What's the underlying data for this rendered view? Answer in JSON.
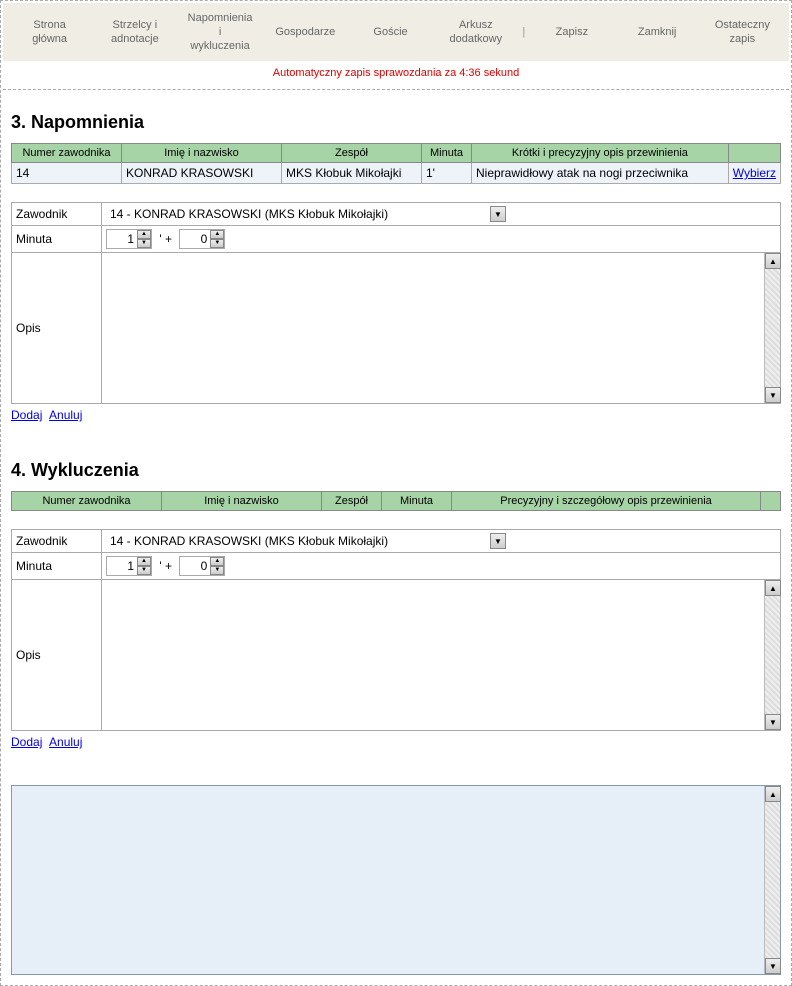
{
  "nav": {
    "items": [
      "Strona\ngłówna",
      "Strzelcy i\nadnotacje",
      "Napomnienia i\nwykluczenia",
      "Gospodarze",
      "Goście",
      "Arkusz\ndodatkowy"
    ],
    "actions": [
      "Zapisz",
      "Zamknij",
      "Ostateczny\nzapis"
    ]
  },
  "autosave": "Automatyczny zapis sprawozdania za 4:36 sekund",
  "section3": {
    "title": "3. Napomnienia",
    "headers": [
      "Numer zawodnika",
      "Imię i nazwisko",
      "Zespół",
      "Minuta",
      "Krótki i precyzyjny opis przewinienia",
      ""
    ],
    "row": {
      "num": "14",
      "name": "KONRAD KRASOWSKI",
      "team": "MKS Kłobuk Mikołajki",
      "minute": "1'",
      "desc": "Nieprawidłowy atak na nogi przeciwnika",
      "action": "Wybierz"
    },
    "form": {
      "zawodnik_label": "Zawodnik",
      "zawodnik_value": "14 - KONRAD KRASOWSKI (MKS Kłobuk Mikołajki)",
      "minuta_label": "Minuta",
      "min1": "1",
      "min2": "0",
      "opis_label": "Opis",
      "opis_value": ""
    },
    "actions": {
      "add": "Dodaj",
      "cancel": "Anuluj"
    }
  },
  "section4": {
    "title": "4. Wykluczenia",
    "headers": [
      "Numer zawodnika",
      "Imię i nazwisko",
      "Zespół",
      "Minuta",
      "Precyzyjny i szczegółowy opis przewinienia",
      ""
    ],
    "form": {
      "zawodnik_label": "Zawodnik",
      "zawodnik_value": "14 - KONRAD KRASOWSKI (MKS Kłobuk Mikołajki)",
      "minuta_label": "Minuta",
      "min1": "1",
      "min2": "0",
      "opis_label": "Opis",
      "opis_value": ""
    },
    "actions": {
      "add": "Dodaj",
      "cancel": "Anuluj"
    }
  },
  "notes_value": ""
}
